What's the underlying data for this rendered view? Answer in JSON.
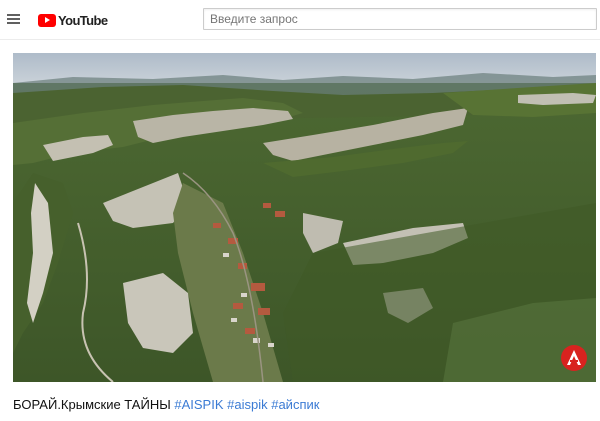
{
  "header": {
    "logo_text": "YouTube",
    "search": {
      "placeholder": "Введите запрос",
      "value": ""
    }
  },
  "video": {
    "badge_letter": "A",
    "badge_color": "#d8231f"
  },
  "description": {
    "title": "БОРАЙ.Крымские ТАЙНЫ",
    "hashtags": [
      "#AISPIK",
      "#aispik",
      "#айспик"
    ]
  },
  "colors": {
    "brand_red": "#ff0000",
    "link_blue": "#3b7bd4"
  }
}
